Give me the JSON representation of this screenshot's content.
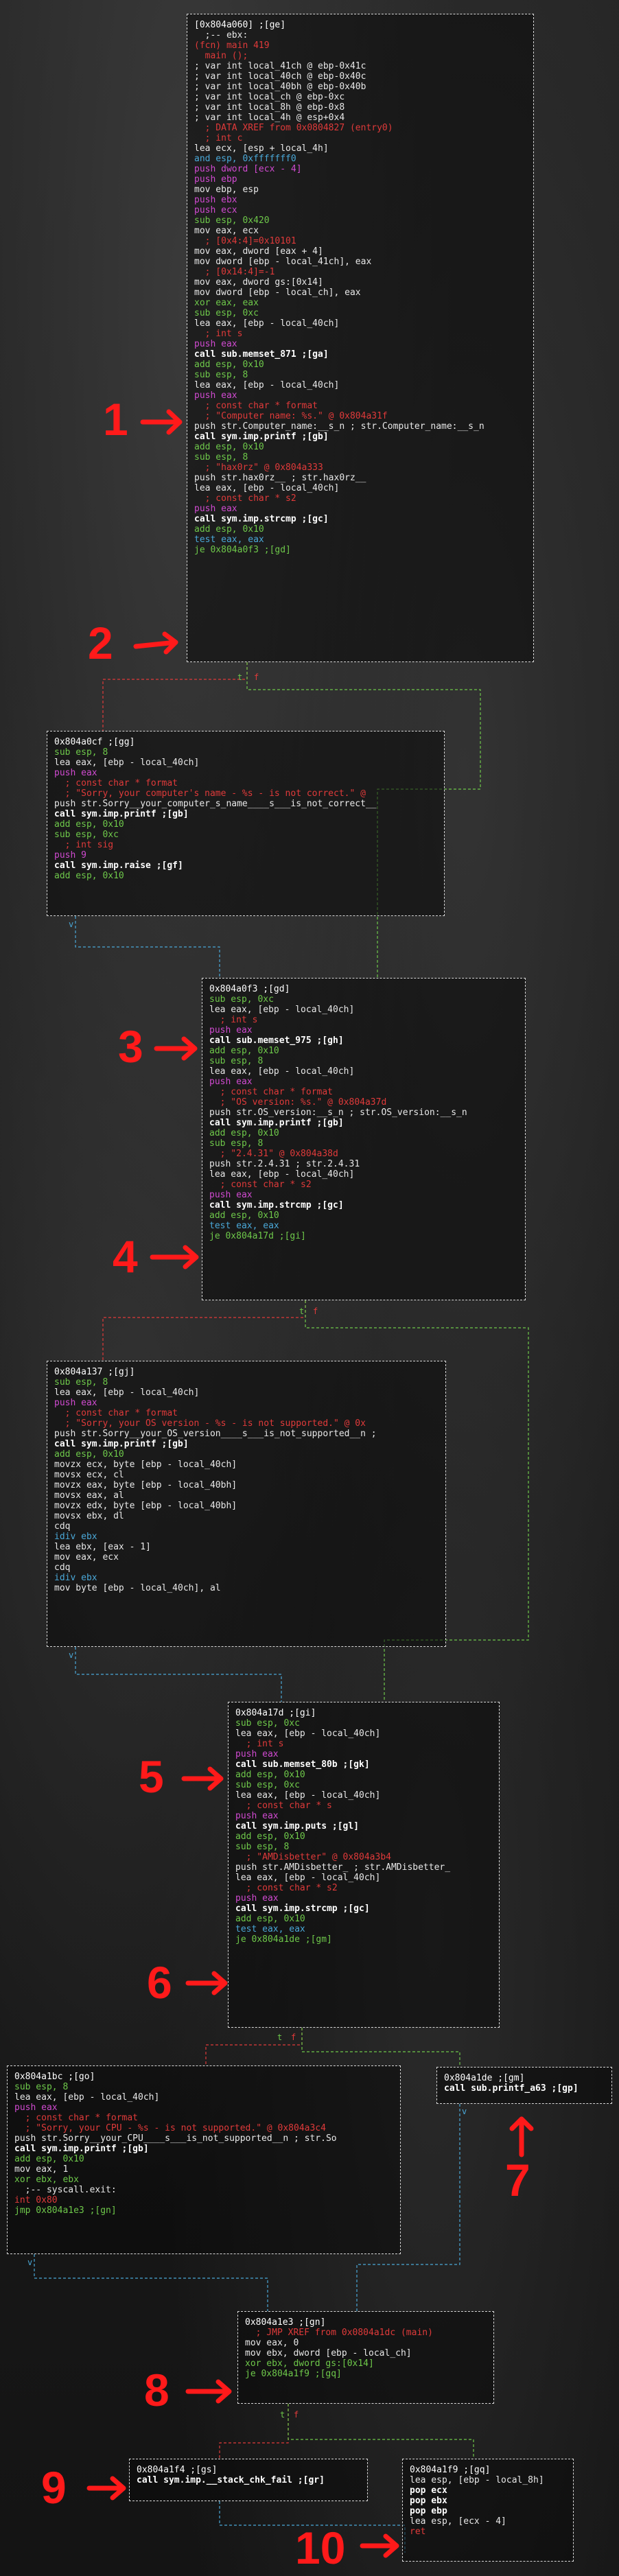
{
  "nodes": {
    "main": {
      "title": "[0x804a060] ;[ge]",
      "lines": [
        {
          "t": "  ;-- ebx:",
          "c": "c-white"
        },
        {
          "t": "(fcn) main 419",
          "c": "c-red"
        },
        {
          "t": "  main ();",
          "c": "c-red"
        },
        {
          "t": "; var int local_41ch @ ebp-0x41c",
          "c": "c-white"
        },
        {
          "t": "; var int local_40ch @ ebp-0x40c",
          "c": "c-white"
        },
        {
          "t": "; var int local_40bh @ ebp-0x40b",
          "c": "c-white"
        },
        {
          "t": "; var int local_ch @ ebp-0xc",
          "c": "c-white"
        },
        {
          "t": "; var int local_8h @ ebp-0x8",
          "c": "c-white"
        },
        {
          "t": "; var int local_4h @ esp+0x4",
          "c": "c-white"
        },
        {
          "t": "  ; DATA XREF from 0x0804827 (entry0)",
          "c": "c-red"
        },
        {
          "t": "  ; int c",
          "c": "c-red"
        },
        {
          "t": "lea ecx, [esp + local_4h]",
          "c": "c-white"
        },
        {
          "t": "and esp, 0xfffffff0",
          "c": "c-blue"
        },
        {
          "t": "push dword [ecx - 4]",
          "c": "c-magenta"
        },
        {
          "t": "push ebp",
          "c": "c-magenta"
        },
        {
          "t": "mov ebp, esp",
          "c": "c-white"
        },
        {
          "t": "push ebx",
          "c": "c-magenta"
        },
        {
          "t": "push ecx",
          "c": "c-magenta"
        },
        {
          "t": "sub esp, 0x420",
          "c": "c-green"
        },
        {
          "t": "mov eax, ecx",
          "c": "c-white"
        },
        {
          "t": "  ; [0x4:4]=0x10101",
          "c": "c-red"
        },
        {
          "t": "mov eax, dword [eax + 4]",
          "c": "c-white"
        },
        {
          "t": "mov dword [ebp - local_41ch], eax",
          "c": "c-white"
        },
        {
          "t": "  ; [0x14:4]=-1",
          "c": "c-red"
        },
        {
          "t": "mov eax, dword gs:[0x14]",
          "c": "c-white"
        },
        {
          "t": "mov dword [ebp - local_ch], eax",
          "c": "c-white"
        },
        {
          "t": "xor eax, eax",
          "c": "c-green"
        },
        {
          "t": "sub esp, 0xc",
          "c": "c-green"
        },
        {
          "t": "lea eax, [ebp - local_40ch]",
          "c": "c-white"
        },
        {
          "t": "  ; int s",
          "c": "c-red"
        },
        {
          "t": "push eax",
          "c": "c-magenta"
        },
        {
          "t": "call sub.memset_871 ;[ga]",
          "c": "c-bold"
        },
        {
          "t": "add esp, 0x10",
          "c": "c-green"
        },
        {
          "t": "sub esp, 8",
          "c": "c-green"
        },
        {
          "t": "lea eax, [ebp - local_40ch]",
          "c": "c-white"
        },
        {
          "t": "push eax",
          "c": "c-magenta"
        },
        {
          "t": "  ; const char * format",
          "c": "c-red"
        },
        {
          "t": "  ; \"Computer name: %s.\" @ 0x804a31f",
          "c": "c-red"
        },
        {
          "t": "push str.Computer_name:__s_n ; str.Computer_name:__s_n",
          "c": "c-white"
        },
        {
          "t": "call sym.imp.printf ;[gb]",
          "c": "c-bold"
        },
        {
          "t": "add esp, 0x10",
          "c": "c-green"
        },
        {
          "t": "sub esp, 8",
          "c": "c-green"
        },
        {
          "t": "  ; \"hax0rz\" @ 0x804a333",
          "c": "c-red"
        },
        {
          "t": "push str.hax0rz__ ; str.hax0rz__",
          "c": "c-white"
        },
        {
          "t": "lea eax, [ebp - local_40ch]",
          "c": "c-white"
        },
        {
          "t": "  ; const char * s2",
          "c": "c-red"
        },
        {
          "t": "push eax",
          "c": "c-magenta"
        },
        {
          "t": "call sym.imp.strcmp ;[gc]",
          "c": "c-bold"
        },
        {
          "t": "add esp, 0x10",
          "c": "c-green"
        },
        {
          "t": "test eax, eax",
          "c": "c-blue"
        },
        {
          "t": "je 0x804a0f3 ;[gd]",
          "c": "c-green"
        }
      ]
    },
    "n_a0cf": {
      "title": "0x804a0cf ;[gg]",
      "lines": [
        {
          "t": "sub esp, 8",
          "c": "c-green"
        },
        {
          "t": "lea eax, [ebp - local_40ch]",
          "c": "c-white"
        },
        {
          "t": "push eax",
          "c": "c-magenta"
        },
        {
          "t": "  ; const char * format",
          "c": "c-red"
        },
        {
          "t": "  ; \"Sorry, your computer's name - %s - is not correct.\" @",
          "c": "c-red"
        },
        {
          "t": "push str.Sorry__your_computer_s_name____s___is_not_correct__",
          "c": "c-white"
        },
        {
          "t": "call sym.imp.printf ;[gb]",
          "c": "c-bold"
        },
        {
          "t": "add esp, 0x10",
          "c": "c-green"
        },
        {
          "t": "sub esp, 0xc",
          "c": "c-green"
        },
        {
          "t": "  ; int sig",
          "c": "c-red"
        },
        {
          "t": "push 9",
          "c": "c-magenta"
        },
        {
          "t": "call sym.imp.raise ;[gf]",
          "c": "c-bold"
        },
        {
          "t": "add esp, 0x10",
          "c": "c-green"
        }
      ]
    },
    "n_a0f3": {
      "title": "0x804a0f3 ;[gd]",
      "lines": [
        {
          "t": "sub esp, 0xc",
          "c": "c-green"
        },
        {
          "t": "lea eax, [ebp - local_40ch]",
          "c": "c-white"
        },
        {
          "t": "  ; int s",
          "c": "c-red"
        },
        {
          "t": "push eax",
          "c": "c-magenta"
        },
        {
          "t": "call sub.memset_975 ;[gh]",
          "c": "c-bold"
        },
        {
          "t": "add esp, 0x10",
          "c": "c-green"
        },
        {
          "t": "sub esp, 8",
          "c": "c-green"
        },
        {
          "t": "lea eax, [ebp - local_40ch]",
          "c": "c-white"
        },
        {
          "t": "push eax",
          "c": "c-magenta"
        },
        {
          "t": "  ; const char * format",
          "c": "c-red"
        },
        {
          "t": "  ; \"OS version: %s.\" @ 0x804a37d",
          "c": "c-red"
        },
        {
          "t": "push str.OS_version:__s_n ; str.OS_version:__s_n",
          "c": "c-white"
        },
        {
          "t": "call sym.imp.printf ;[gb]",
          "c": "c-bold"
        },
        {
          "t": "add esp, 0x10",
          "c": "c-green"
        },
        {
          "t": "sub esp, 8",
          "c": "c-green"
        },
        {
          "t": "  ; \"2.4.31\" @ 0x804a38d",
          "c": "c-red"
        },
        {
          "t": "push str.2.4.31 ; str.2.4.31",
          "c": "c-white"
        },
        {
          "t": "lea eax, [ebp - local_40ch]",
          "c": "c-white"
        },
        {
          "t": "  ; const char * s2",
          "c": "c-red"
        },
        {
          "t": "push eax",
          "c": "c-magenta"
        },
        {
          "t": "call sym.imp.strcmp ;[gc]",
          "c": "c-bold"
        },
        {
          "t": "add esp, 0x10",
          "c": "c-green"
        },
        {
          "t": "test eax, eax",
          "c": "c-blue"
        },
        {
          "t": "je 0x804a17d ;[gi]",
          "c": "c-green"
        }
      ]
    },
    "n_a137": {
      "title": "0x804a137 ;[gj]",
      "lines": [
        {
          "t": "sub esp, 8",
          "c": "c-green"
        },
        {
          "t": "lea eax, [ebp - local_40ch]",
          "c": "c-white"
        },
        {
          "t": "push eax",
          "c": "c-magenta"
        },
        {
          "t": "  ; const char * format",
          "c": "c-red"
        },
        {
          "t": "  ; \"Sorry, your OS version - %s - is not supported.\" @ 0x",
          "c": "c-red"
        },
        {
          "t": "push str.Sorry__your_OS_version____s___is_not_supported__n ;",
          "c": "c-white"
        },
        {
          "t": "call sym.imp.printf ;[gb]",
          "c": "c-bold"
        },
        {
          "t": "add esp, 0x10",
          "c": "c-green"
        },
        {
          "t": "movzx ecx, byte [ebp - local_40ch]",
          "c": "c-white"
        },
        {
          "t": "movsx ecx, cl",
          "c": "c-white"
        },
        {
          "t": "movzx eax, byte [ebp - local_40bh]",
          "c": "c-white"
        },
        {
          "t": "movsx eax, al",
          "c": "c-white"
        },
        {
          "t": "movzx edx, byte [ebp - local_40bh]",
          "c": "c-white"
        },
        {
          "t": "movsx ebx, dl",
          "c": "c-white"
        },
        {
          "t": "cdq",
          "c": "c-white"
        },
        {
          "t": "idiv ebx",
          "c": "c-blue"
        },
        {
          "t": "lea ebx, [eax - 1]",
          "c": "c-white"
        },
        {
          "t": "mov eax, ecx",
          "c": "c-white"
        },
        {
          "t": "cdq",
          "c": "c-white"
        },
        {
          "t": "idiv ebx",
          "c": "c-blue"
        },
        {
          "t": "mov byte [ebp - local_40ch], al",
          "c": "c-white"
        }
      ]
    },
    "n_a17d": {
      "title": "0x804a17d ;[gi]",
      "lines": [
        {
          "t": "sub esp, 0xc",
          "c": "c-green"
        },
        {
          "t": "lea eax, [ebp - local_40ch]",
          "c": "c-white"
        },
        {
          "t": "  ; int s",
          "c": "c-red"
        },
        {
          "t": "push eax",
          "c": "c-magenta"
        },
        {
          "t": "call sub.memset_80b ;[gk]",
          "c": "c-bold"
        },
        {
          "t": "add esp, 0x10",
          "c": "c-green"
        },
        {
          "t": "sub esp, 0xc",
          "c": "c-green"
        },
        {
          "t": "lea eax, [ebp - local_40ch]",
          "c": "c-white"
        },
        {
          "t": "  ; const char * s",
          "c": "c-red"
        },
        {
          "t": "push eax",
          "c": "c-magenta"
        },
        {
          "t": "call sym.imp.puts ;[gl]",
          "c": "c-bold"
        },
        {
          "t": "add esp, 0x10",
          "c": "c-green"
        },
        {
          "t": "sub esp, 8",
          "c": "c-green"
        },
        {
          "t": "  ; \"AMDisbetter\" @ 0x804a3b4",
          "c": "c-red"
        },
        {
          "t": "push str.AMDisbetter_ ; str.AMDisbetter_",
          "c": "c-white"
        },
        {
          "t": "lea eax, [ebp - local_40ch]",
          "c": "c-white"
        },
        {
          "t": "  ; const char * s2",
          "c": "c-red"
        },
        {
          "t": "push eax",
          "c": "c-magenta"
        },
        {
          "t": "call sym.imp.strcmp ;[gc]",
          "c": "c-bold"
        },
        {
          "t": "add esp, 0x10",
          "c": "c-green"
        },
        {
          "t": "test eax, eax",
          "c": "c-blue"
        },
        {
          "t": "je 0x804a1de ;[gm]",
          "c": "c-green"
        }
      ]
    },
    "n_a1bc": {
      "title": "0x804a1bc ;[go]",
      "lines": [
        {
          "t": "sub esp, 8",
          "c": "c-green"
        },
        {
          "t": "lea eax, [ebp - local_40ch]",
          "c": "c-white"
        },
        {
          "t": "push eax",
          "c": "c-magenta"
        },
        {
          "t": "  ; const char * format",
          "c": "c-red"
        },
        {
          "t": "  ; \"Sorry, your CPU - %s - is not supported.\" @ 0x804a3c4",
          "c": "c-red"
        },
        {
          "t": "push str.Sorry__your_CPU____s___is_not_supported__n ; str.So",
          "c": "c-white"
        },
        {
          "t": "call sym.imp.printf ;[gb]",
          "c": "c-bold"
        },
        {
          "t": "add esp, 0x10",
          "c": "c-green"
        },
        {
          "t": "mov eax, 1",
          "c": "c-white"
        },
        {
          "t": "xor ebx, ebx",
          "c": "c-green"
        },
        {
          "t": "  ;-- syscall.exit:",
          "c": "c-white"
        },
        {
          "t": "int 0x80",
          "c": "c-red"
        },
        {
          "t": "jmp 0x804a1e3 ;[gn]",
          "c": "c-green"
        }
      ]
    },
    "n_a1de": {
      "title": "0x804a1de ;[gm]",
      "lines": [
        {
          "t": "call sub.printf_a63 ;[gp]",
          "c": "c-bold"
        }
      ]
    },
    "n_a1e3": {
      "title": "0x804a1e3 ;[gn]",
      "lines": [
        {
          "t": "  ; JMP XREF from 0x0804a1dc (main)",
          "c": "c-red"
        },
        {
          "t": "mov eax, 0",
          "c": "c-white"
        },
        {
          "t": "mov ebx, dword [ebp - local_ch]",
          "c": "c-white"
        },
        {
          "t": "xor ebx, dword gs:[0x14]",
          "c": "c-green"
        },
        {
          "t": "je 0x804a1f9 ;[gq]",
          "c": "c-green"
        }
      ]
    },
    "n_a1f4": {
      "title": "0x804a1f4 ;[gs]",
      "lines": [
        {
          "t": "call sym.imp.__stack_chk_fail ;[gr]",
          "c": "c-bold"
        }
      ]
    },
    "n_a1f9": {
      "title": "0x804a1f9 ;[gq]",
      "lines": [
        {
          "t": "lea esp, [ebp - local_8h]",
          "c": "c-white"
        },
        {
          "t": "pop ecx",
          "c": "c-bold"
        },
        {
          "t": "pop ebx",
          "c": "c-bold"
        },
        {
          "t": "pop ebp",
          "c": "c-bold"
        },
        {
          "t": "lea esp, [ecx - 4]",
          "c": "c-white"
        },
        {
          "t": "ret",
          "c": "c-red"
        }
      ]
    }
  },
  "edge_labels": {
    "true": "t",
    "false": "f",
    "down": "v"
  },
  "annotations": [
    "1",
    "2",
    "3",
    "4",
    "5",
    "6",
    "7",
    "8",
    "9",
    "10"
  ],
  "colors": {
    "background": "#1c1c1c",
    "annotation": "#ff1a1a",
    "edge_true": "#6ec84a",
    "edge_false": "#e03a3a",
    "edge_jump": "#4aa8d8"
  }
}
